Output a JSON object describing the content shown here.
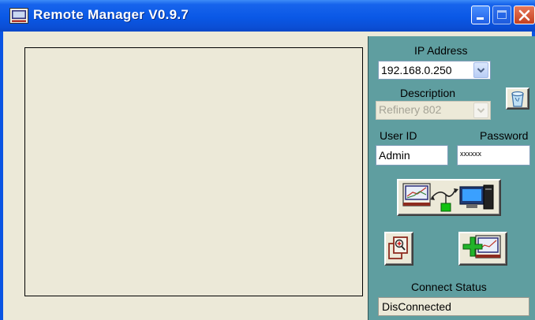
{
  "window": {
    "title": "Remote Manager V0.9.7"
  },
  "connection": {
    "ip_label": "IP Address",
    "ip_value": "192.168.0.250",
    "description_label": "Description",
    "description_value": "Refinery 802",
    "userid_label": "User ID",
    "userid_value": "Admin",
    "password_label": "Password",
    "password_value": "xxxxxx",
    "status_label": "Connect Status",
    "status_value": "DisConnected"
  },
  "icons": {
    "app": "monitor-app-icon",
    "minimize": "minimize-icon",
    "maximize": "maximize-icon",
    "close": "close-icon",
    "dropdown": "chevron-down-icon",
    "recycle": "recycle-bin-icon",
    "connect": "connect-recorder-to-computer-icon",
    "zoom": "zoom-window-icon",
    "add": "add-recorder-icon"
  },
  "colors": {
    "titlebar": "#0a58e6",
    "panel": "#5f9ea0",
    "client": "#ece9d8",
    "close_button": "#d9552f"
  }
}
